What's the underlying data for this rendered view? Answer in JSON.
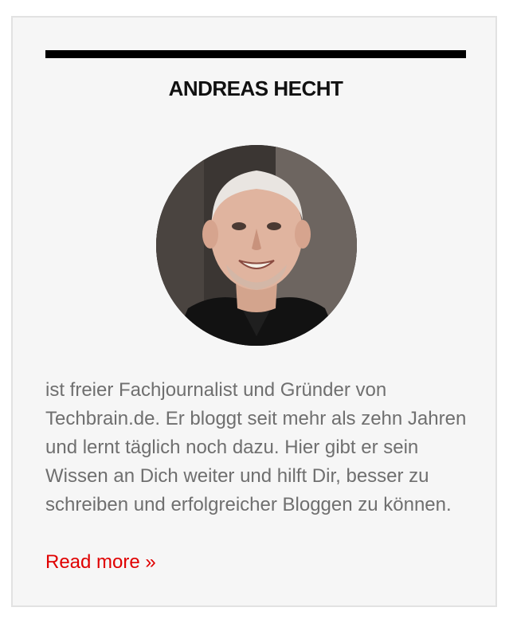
{
  "author_widget": {
    "name": "ANDREAS HECHT",
    "avatar_icon": "author-photo",
    "bio": "ist freier Fachjournalist und Gründer von Techbrain.de. Er bloggt seit mehr als zehn Jahren und lernt täglich noch dazu. Hier gibt er sein Wissen an Dich weiter und hilft Dir, besser zu schreiben und erfolgreicher Bloggen zu können.",
    "read_more_label": "Read more »"
  },
  "colors": {
    "panel_background": "#f6f6f6",
    "panel_border": "#e2e2e2",
    "heading": "#111111",
    "body_text": "#6f6f6f",
    "link": "#e00000"
  }
}
